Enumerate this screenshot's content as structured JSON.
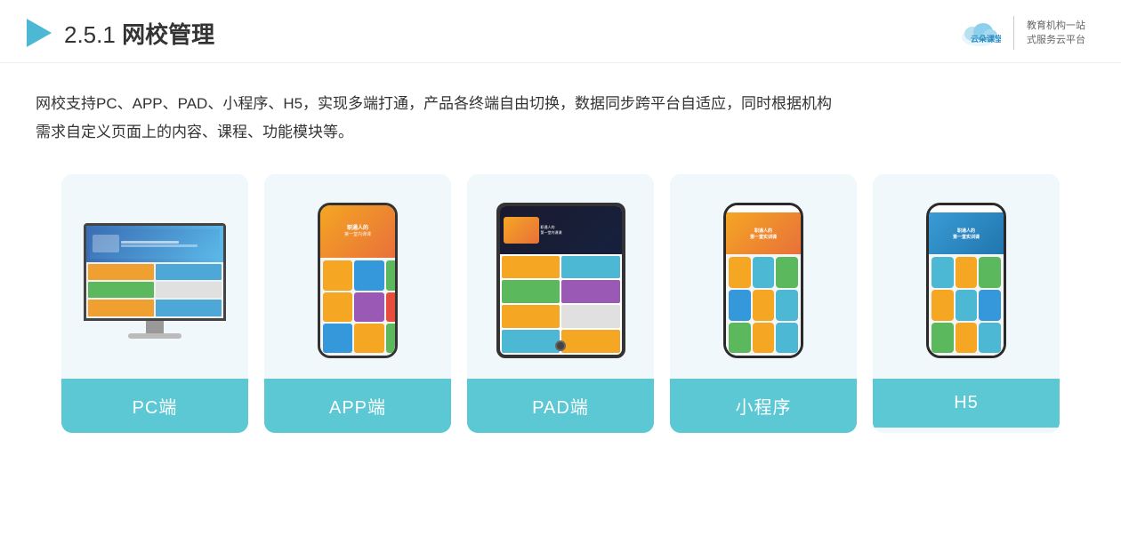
{
  "header": {
    "title_prefix": "2.5.1 ",
    "title_main": "网校管理",
    "brand_name": "云朵课堂",
    "brand_url": "yunduoketang.com",
    "brand_slogan_line1": "教育机构一站",
    "brand_slogan_line2": "式服务云平台"
  },
  "description": {
    "text_line1": "网校支持PC、APP、PAD、小程序、H5，实现多端打通，产品各终端自由切换，数据同步跨平台自适应，同时根据机构",
    "text_line2": "需求自定义页面上的内容、课程、功能模块等。"
  },
  "cards": [
    {
      "id": "pc",
      "label": "PC端"
    },
    {
      "id": "app",
      "label": "APP端"
    },
    {
      "id": "pad",
      "label": "PAD端"
    },
    {
      "id": "miniprogram",
      "label": "小程序"
    },
    {
      "id": "h5",
      "label": "H5"
    }
  ],
  "colors": {
    "teal": "#5bc8d4",
    "accent_orange": "#f5a623",
    "bg_light": "#f0f8fb"
  }
}
